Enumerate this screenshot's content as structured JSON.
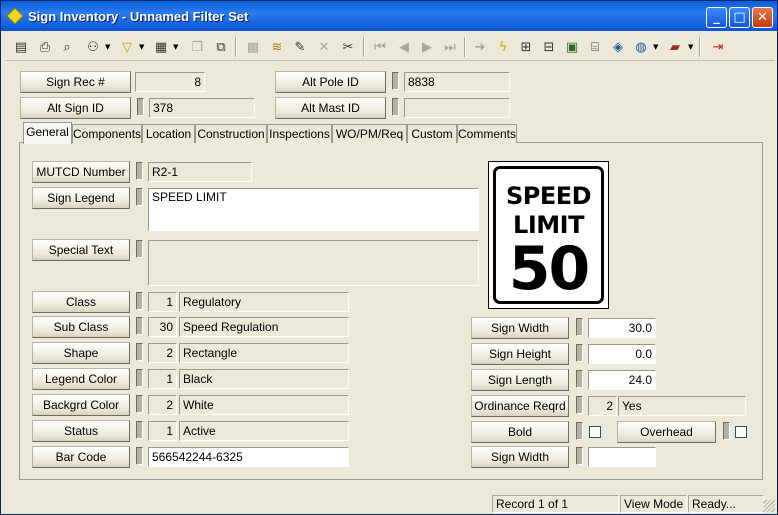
{
  "window": {
    "title": "Sign Inventory - Unnamed Filter Set",
    "minimize_glyph": "_",
    "maximize_glyph": "□",
    "close_glyph": "✕"
  },
  "toolbar": {
    "icons": [
      "list-icon",
      "print-icon",
      "print-preview-icon",
      "binoculars-icon",
      "filter-icon",
      "report-icon",
      "copy-icon",
      "paste-icon",
      "grid-icon",
      "layers-icon",
      "pencil-icon",
      "delete-icon",
      "cut-icon",
      "first-record-icon",
      "prev-record-icon",
      "next-record-icon",
      "last-record-icon",
      "goto-icon",
      "lightning-icon",
      "map-icon",
      "hierarchy-icon",
      "picture-icon",
      "calculator-icon",
      "map-layers-icon",
      "globe-icon",
      "book-icon",
      "exit-icon"
    ]
  },
  "header": {
    "sign_rec_label": "Sign Rec #",
    "sign_rec_value": "8",
    "alt_sign_id_label": "Alt Sign ID",
    "alt_sign_id_value": "378",
    "alt_pole_id_label": "Alt Pole ID",
    "alt_pole_id_value": "8838",
    "alt_mast_id_label": "Alt Mast ID",
    "alt_mast_id_value": ""
  },
  "tabs": [
    "General",
    "Components",
    "Location",
    "Construction",
    "Inspections",
    "WO/PM/Req",
    "Custom",
    "Comments"
  ],
  "general": {
    "mutcd_label": "MUTCD Number",
    "mutcd_value": "R2-1",
    "legend_label": "Sign Legend",
    "legend_value": "SPEED LIMIT",
    "special_label": "Special Text",
    "special_value": "",
    "class_label": "Class",
    "class_code": "1",
    "class_value": "Regulatory",
    "subclass_label": "Sub Class",
    "subclass_code": "30",
    "subclass_value": "Speed Regulation",
    "shape_label": "Shape",
    "shape_code": "2",
    "shape_value": "Rectangle",
    "legend_color_label": "Legend Color",
    "legend_color_code": "1",
    "legend_color_value": "Black",
    "backgrd_color_label": "Backgrd Color",
    "backgrd_color_code": "2",
    "backgrd_color_value": "White",
    "status_label": "Status",
    "status_code": "1",
    "status_value": "Active",
    "barcode_label": "Bar Code",
    "barcode_value": "566542244-6325",
    "sign_width_label": "Sign Width",
    "sign_width_value": "30.0",
    "sign_height_label": "Sign Height",
    "sign_height_value": "0.0",
    "sign_length_label": "Sign Length",
    "sign_length_value": "24.0",
    "ordinance_label": "Ordinance Reqrd",
    "ordinance_code": "2",
    "ordinance_value": "Yes",
    "bold_label": "Bold",
    "overhead_label": "Overhead",
    "sign_width2_label": "Sign Width",
    "sign_width2_value": ""
  },
  "sign_image": {
    "line1": "SPEED",
    "line2": "LIMIT",
    "number": "50"
  },
  "statusbar": {
    "record": "Record 1 of 1",
    "mode": "View Mode",
    "state": "Ready..."
  }
}
